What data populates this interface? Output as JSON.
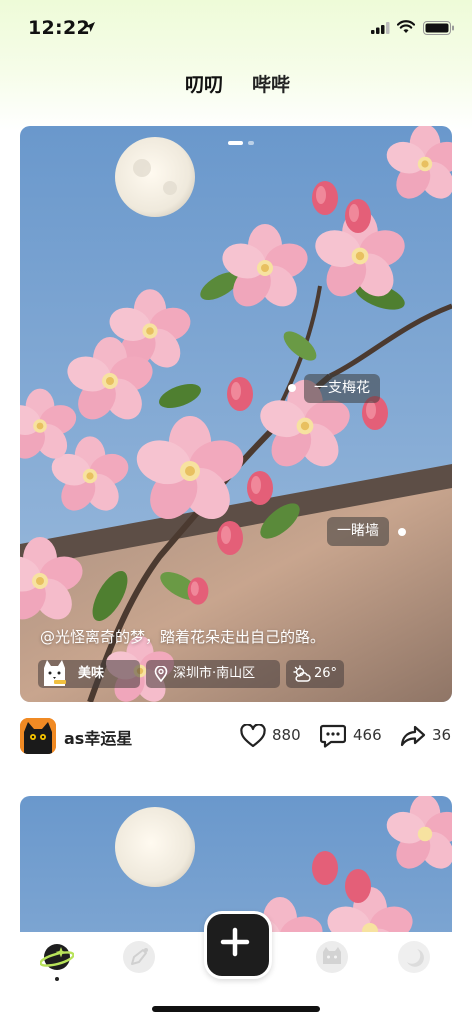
{
  "status_bar": {
    "time": "12:22",
    "icons": [
      "location-arrow-icon",
      "signal-icon",
      "wifi-icon",
      "battery-icon"
    ]
  },
  "tabs": [
    {
      "label": "叨叨",
      "active": true
    },
    {
      "label": "哔哔",
      "active": false
    }
  ],
  "post": {
    "tags": [
      "一支梅花",
      "一睹墙"
    ],
    "caption": "@光怪离奇的梦，踏着花朵走出自己的路。",
    "mood_label": "美味",
    "location": "深圳市·南山区",
    "weather": "26°",
    "author": "as幸运星",
    "likes": "880",
    "comments": "466",
    "shares": "36",
    "carousel_pages": 2,
    "carousel_active": 1
  },
  "bottom_nav": {
    "items": [
      "planet-icon",
      "discover-icon",
      "cat-icon",
      "moon-icon"
    ],
    "fab_icon": "plus-icon"
  },
  "colors": {
    "accent": "#c8f078",
    "fab": "#1d1d1d",
    "sky": "#6f9fd0"
  }
}
